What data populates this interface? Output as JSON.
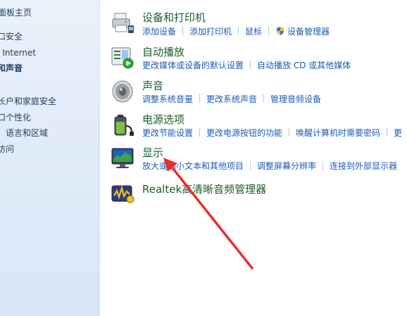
{
  "sidebar": {
    "items": [
      {
        "label": "面板主页",
        "bold": false
      },
      {
        "label": "口安全",
        "bold": false
      },
      {
        "label": "I Internet",
        "bold": false
      },
      {
        "label": "和声音",
        "bold": true
      },
      {
        "label": "长户和家庭安全",
        "bold": false
      },
      {
        "label": "口个性化",
        "bold": false
      },
      {
        "label": "、语言和区域",
        "bold": false
      },
      {
        "label": "访问",
        "bold": false
      }
    ]
  },
  "categories": [
    {
      "title": "设备和打印机",
      "icon": "printer-icon",
      "links": [
        "添加设备",
        "添加打印机",
        "鼠标",
        "设备管理器"
      ],
      "shield_on_link": 3
    },
    {
      "title": "自动播放",
      "icon": "autoplay-icon",
      "links": [
        "更改媒体或设备的默认设置",
        "自动播放 CD 或其他媒体"
      ]
    },
    {
      "title": "声音",
      "icon": "speaker-icon",
      "links": [
        "调整系统音量",
        "更改系统声音",
        "管理音频设备"
      ]
    },
    {
      "title": "电源选项",
      "icon": "battery-icon",
      "links": [
        "更改节能设置",
        "更改电源按钮的功能",
        "唤醒计算机时需要密码",
        "更"
      ]
    },
    {
      "title": "显示",
      "icon": "monitor-icon",
      "links": [
        "放大或缩小文本和其他项目",
        "调整屏幕分辨率",
        "连接到外部显示器"
      ]
    },
    {
      "title": "Realtek高清晰音频管理器",
      "icon": "realtek-audio-icon",
      "links": []
    }
  ],
  "colors": {
    "category_title": "#1e5d2a",
    "link": "#1c5bb4",
    "arrow": "#e8302c",
    "sidebar_bg": "#dfeaf8"
  }
}
